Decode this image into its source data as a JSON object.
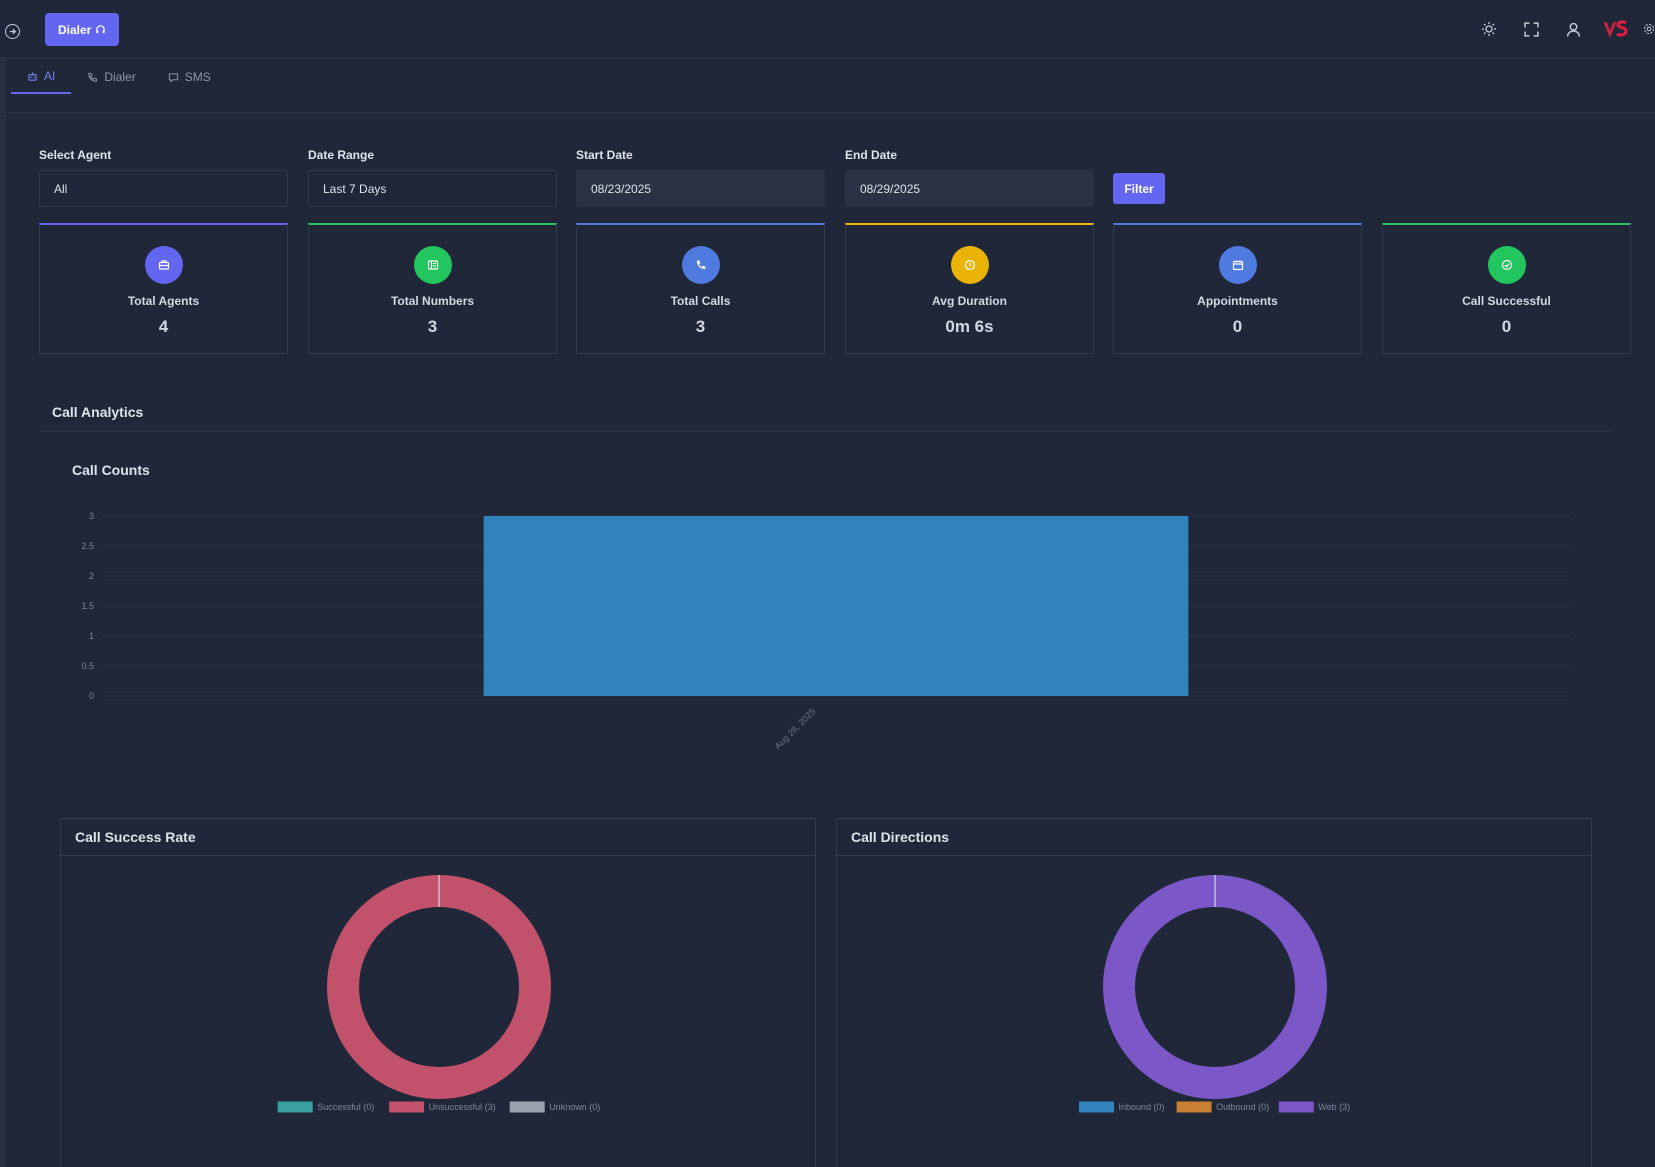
{
  "topbar": {
    "dialer_label": "Dialer",
    "icons": [
      "theme-toggle-icon",
      "fullscreen-icon",
      "user-icon",
      "brand-logo-icon",
      "settings-icon"
    ]
  },
  "tabs": [
    {
      "label": "AI",
      "icon": "robot-icon",
      "active": true
    },
    {
      "label": "Dialer",
      "icon": "phone-icon",
      "active": false
    },
    {
      "label": "SMS",
      "icon": "message-icon",
      "active": false
    }
  ],
  "filters": {
    "agent": {
      "label": "Select Agent",
      "value": "All"
    },
    "range": {
      "label": "Date Range",
      "value": "Last 7 Days"
    },
    "start": {
      "label": "Start Date",
      "value": "08/23/2025"
    },
    "end": {
      "label": "End Date",
      "value": "08/29/2025"
    },
    "button": "Filter"
  },
  "stats": [
    {
      "title": "Total Agents",
      "value": "4",
      "color": "#6366f1",
      "icon": "briefcase-icon"
    },
    {
      "title": "Total Numbers",
      "value": "3",
      "color": "#22c55e",
      "icon": "list-icon"
    },
    {
      "title": "Total Calls",
      "value": "3",
      "color": "#4f7be0",
      "icon": "phone-icon"
    },
    {
      "title": "Avg Duration",
      "value": "0m 6s",
      "color": "#eab308",
      "icon": "clock-icon"
    },
    {
      "title": "Appointments",
      "value": "0",
      "color": "#4f7be0",
      "icon": "calendar-icon"
    },
    {
      "title": "Call Successful",
      "value": "0",
      "color": "#22c55e",
      "icon": "check-circle-icon"
    }
  ],
  "section": {
    "title": "Call Analytics"
  },
  "chart_data": [
    {
      "type": "bar",
      "title": "Call Counts",
      "categories": [
        "Aug 28, 2025"
      ],
      "values": [
        3
      ],
      "ylim": [
        0,
        3
      ],
      "yticks": [
        "0",
        "0.5",
        "1",
        "1.5",
        "2",
        "2.5",
        "3"
      ],
      "color": "#3182bd",
      "grid": true
    },
    {
      "type": "pie",
      "title": "Call Success Rate",
      "labels": [
        "Successful (0)",
        "Unsuccessful (3)",
        "Unknown (0)"
      ],
      "values": [
        0,
        3,
        0
      ],
      "colors": [
        "#3aa0a0",
        "#c2526c",
        "#9ca3af"
      ],
      "legend": "bottom"
    },
    {
      "type": "pie",
      "title": "Call Directions",
      "labels": [
        "Inbound (0)",
        "Outbound (0)",
        "Web (3)"
      ],
      "values": [
        0,
        0,
        3
      ],
      "colors": [
        "#3182bd",
        "#c98033",
        "#7b57c7"
      ],
      "legend": "bottom"
    }
  ]
}
